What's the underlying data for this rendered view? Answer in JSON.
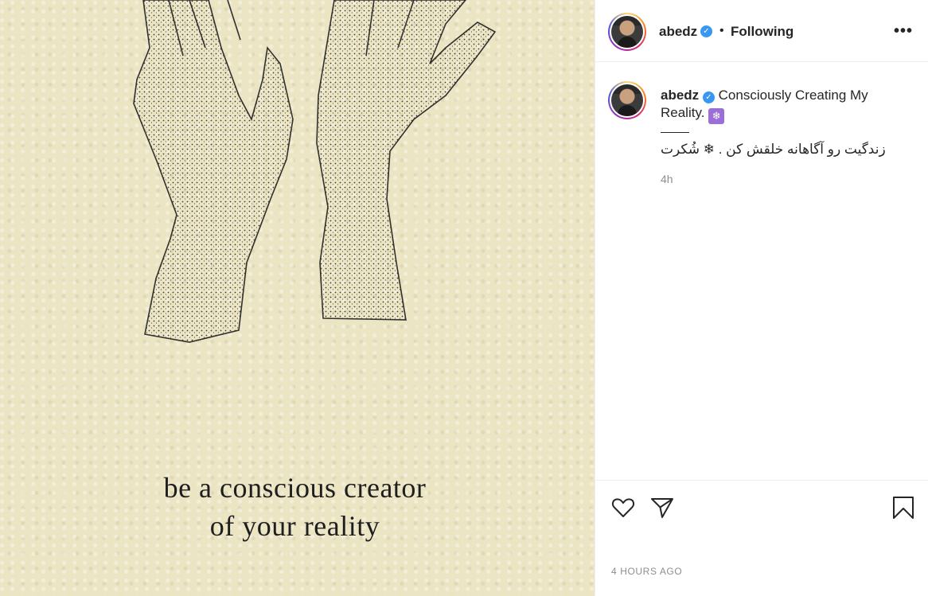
{
  "post": {
    "image": {
      "alt": "",
      "line1": "be a conscious creator",
      "line2": "of your reality"
    },
    "header": {
      "username": "abedz",
      "verified_icon": "verified-badge-icon",
      "separator": "•",
      "follow_label": "Following",
      "more_icon": "more-options-icon",
      "more_glyph": "•••"
    },
    "caption": {
      "username": "abedz",
      "text": "Consciously Creating My Reality.",
      "emoji": "❄",
      "persian": "زندگیت رو آگاهانه خلقش کن . ❄ شُکرت",
      "time": "4h"
    },
    "actions": {
      "like_icon": "heart-icon",
      "share_icon": "paper-plane-icon",
      "save_icon": "bookmark-icon"
    },
    "timestamp": "4 HOURS AGO",
    "colors": {
      "verified": "#3897f0",
      "muted": "#8e8e8e",
      "text": "#262626",
      "paper": "#ece5c4",
      "sparkle": "#9b6fd6"
    }
  }
}
